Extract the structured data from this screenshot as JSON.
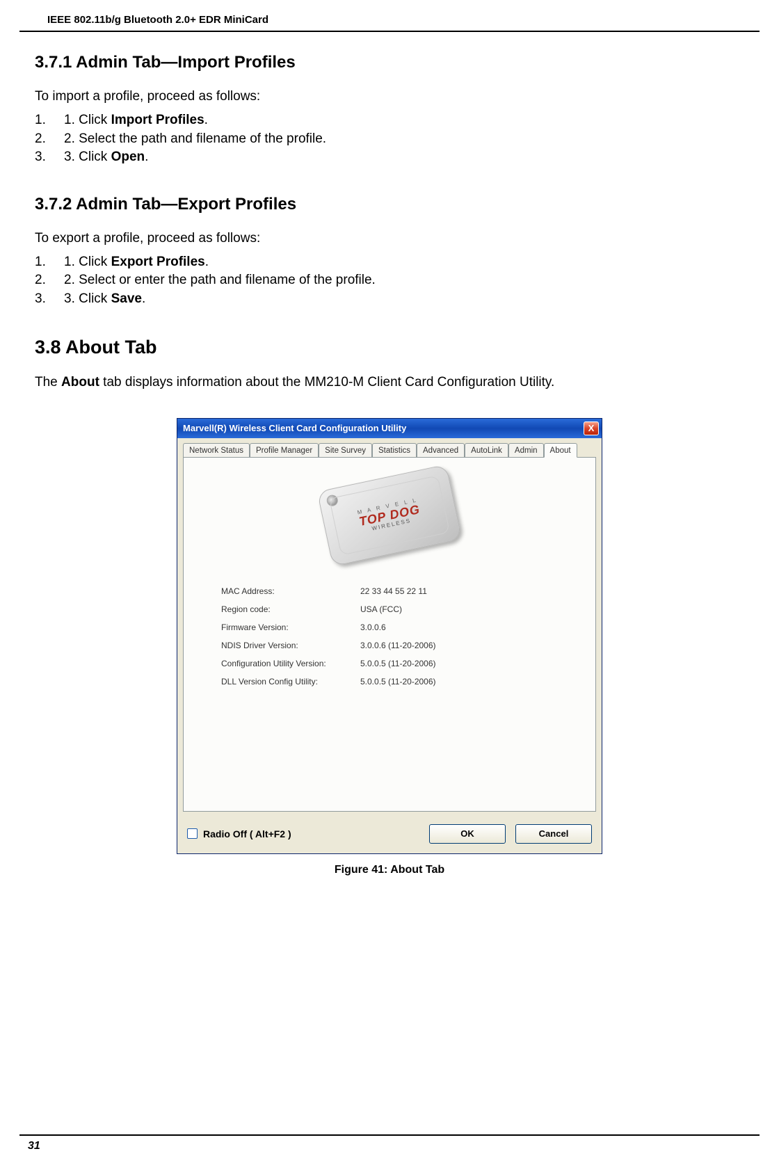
{
  "header": {
    "title": "IEEE 802.11b/g Bluetooth 2.0+ EDR MiniCard"
  },
  "footer": {
    "page_number": "31"
  },
  "sec_371": {
    "heading": "3.7.1 Admin Tab—Import Profiles",
    "intro": "To import a profile, proceed as follows:",
    "items": [
      {
        "num": "1.",
        "text_prefix": "1. Click ",
        "bold": "Import Profiles",
        "text_suffix": "."
      },
      {
        "num": "2.",
        "text_prefix": "2. Select the path and filename of the profile.",
        "bold": "",
        "text_suffix": ""
      },
      {
        "num": "3.",
        "text_prefix": "3. Click ",
        "bold": "Open",
        "text_suffix": "."
      }
    ]
  },
  "sec_372": {
    "heading": "3.7.2 Admin Tab—Export Profiles",
    "intro": "To export a profile, proceed as follows:",
    "items": [
      {
        "num": "1.",
        "text_prefix": "1. Click ",
        "bold": "Export Profiles",
        "text_suffix": "."
      },
      {
        "num": "2.",
        "text_prefix": "2. Select or enter the path and filename of the profile.",
        "bold": "",
        "text_suffix": ""
      },
      {
        "num": "3.",
        "text_prefix": "3. Click ",
        "bold": "Save",
        "text_suffix": "."
      }
    ]
  },
  "sec_38": {
    "heading": "3.8 About Tab",
    "para_prefix": "The ",
    "para_bold": "About",
    "para_suffix": " tab displays information about the MM210-M Client Card Configuration Utility."
  },
  "app": {
    "title": "Marvell(R) Wireless Client Card Configuration Utility",
    "close_glyph": "X",
    "tabs": [
      "Network Status",
      "Profile Manager",
      "Site Survey",
      "Statistics",
      "Advanced",
      "AutoLink",
      "Admin",
      "About"
    ],
    "active_tab_index": 7,
    "logo": {
      "brand": "M A R V E L L",
      "line1": "TOP DOG",
      "line2": "WIRELESS"
    },
    "info": [
      {
        "label": "MAC Address:",
        "value": "22 33 44 55 22 11"
      },
      {
        "label": "Region code:",
        "value": "USA (FCC)"
      },
      {
        "label": "Firmware Version:",
        "value": "3.0.0.6"
      },
      {
        "label": "NDIS Driver Version:",
        "value": "3.0.0.6 (11-20-2006)"
      },
      {
        "label": "Configuration Utility Version:",
        "value": "5.0.0.5 (11-20-2006)"
      },
      {
        "label": "DLL Version Config Utility:",
        "value": "5.0.0.5 (11-20-2006)"
      }
    ],
    "radio_off_label": "Radio Off  ( Alt+F2 )",
    "buttons": {
      "ok": "OK",
      "cancel": "Cancel"
    }
  },
  "caption": "Figure 41: About Tab"
}
